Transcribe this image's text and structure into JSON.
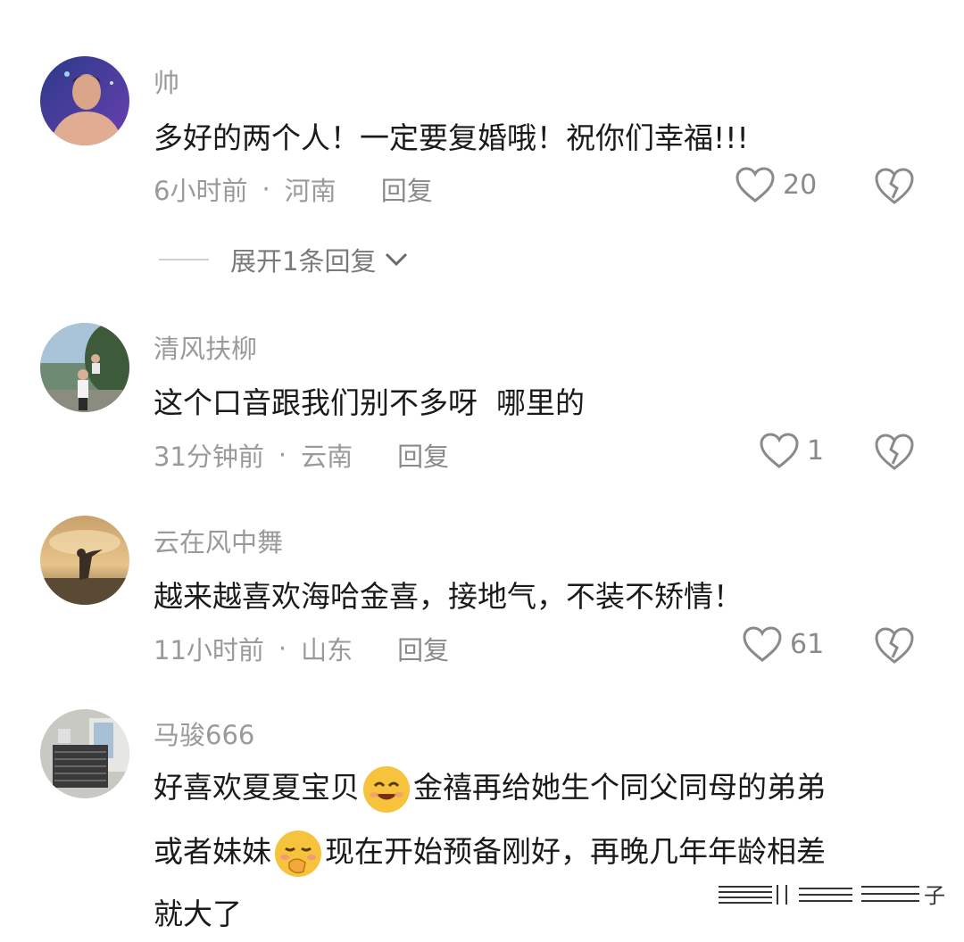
{
  "comments": [
    {
      "username": "帅",
      "content_lines": [
        "多好的两个人！一定要复婚哦！祝你们幸福!!!"
      ],
      "time": "6小时前",
      "separator": "·",
      "location": "河南",
      "reply_label": "回复",
      "likes": "20",
      "avatar_icon": "avatar-photo-man",
      "expand_label": "展开1条回复"
    },
    {
      "username": "清风扶柳",
      "content_lines": [
        "这个口音跟我们别不多呀  哪里的"
      ],
      "time": "31分钟前",
      "separator": "·",
      "location": "云南",
      "reply_label": "回复",
      "likes": "1",
      "avatar_icon": "avatar-photo-family"
    },
    {
      "username": "云在风中舞",
      "content_lines": [
        "越来越喜欢海哈金喜，接地气，不装不矫情！"
      ],
      "time": "11小时前",
      "separator": "·",
      "location": "山东",
      "reply_label": "回复",
      "likes": "61",
      "avatar_icon": "avatar-photo-sunset"
    },
    {
      "username": "马骏666",
      "content_parts": {
        "line1_a": "好喜欢夏夏宝贝",
        "line1_emoji": "smile-emoji",
        "line1_b": "金禧再给她生个同父同母的弟弟",
        "line2_a": "或者妹妹",
        "line2_emoji": "shy-emoji",
        "line2_b": "现在开始预备刚好，再晚几年年龄相差",
        "line3": "就大了"
      },
      "avatar_icon": "avatar-photo-room"
    }
  ],
  "icons": {
    "like": "heart-outline-icon",
    "dislike": "broken-heart-icon",
    "expand": "chevron-down-icon"
  },
  "watermark_text": "子",
  "colors": {
    "text_primary": "#1a1a1a",
    "text_secondary": "#9a9a9a",
    "icon": "#8a8a8a"
  }
}
